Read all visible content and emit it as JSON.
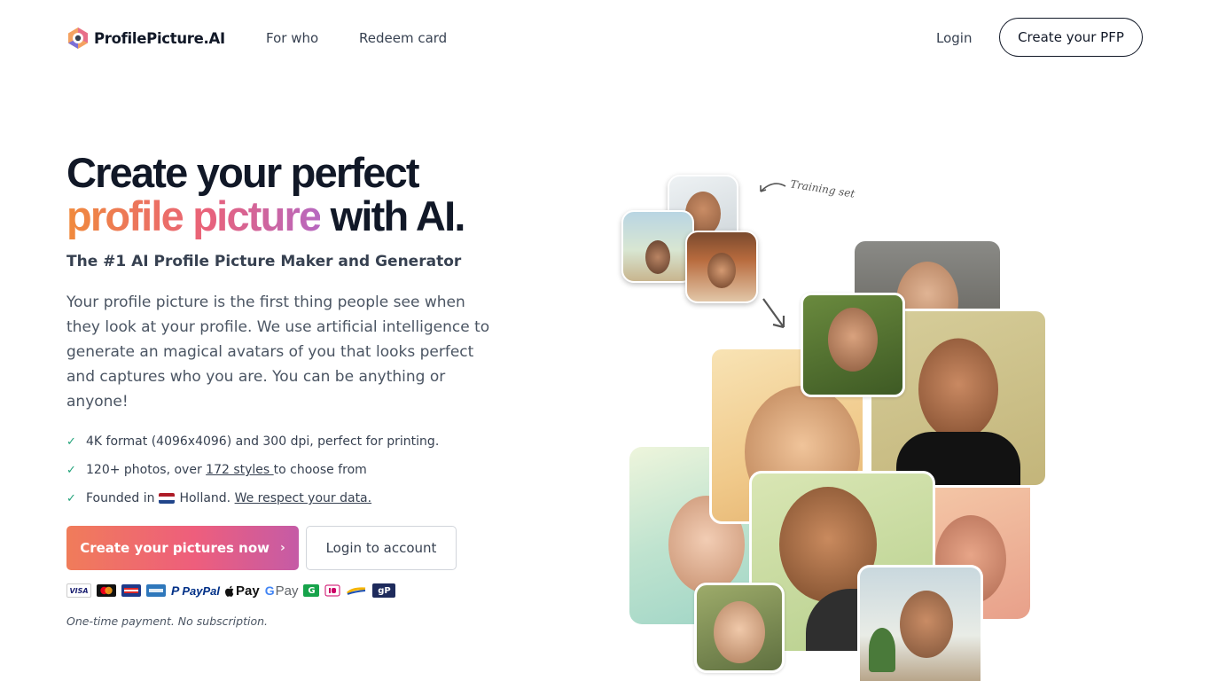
{
  "brand": {
    "name": "ProfilePicture.AI"
  },
  "nav": {
    "for_who": "For who",
    "redeem_card": "Redeem card",
    "login": "Login",
    "cta": "Create your PFP"
  },
  "hero": {
    "title_line1": "Create your perfect",
    "title_highlight": "profile picture",
    "title_rest": " with AI.",
    "subtitle": "The #1 AI Profile Picture Maker and Generator",
    "paragraph": "Your profile picture is the first thing people see when they look at your profile. We use artificial intelligence to generate an magical avatars of you that looks perfect and captures who you are. You can be anything or anyone!"
  },
  "features": {
    "f1": "4K format (4096x4096) and 300 dpi, perfect for printing.",
    "f2_pre": "120+ photos, over ",
    "f2_link": "172 styles ",
    "f2_post": "to choose from",
    "f3_pre": "Founded in",
    "f3_country": "Holland.",
    "f3_link": "We respect your data."
  },
  "cta": {
    "primary": "Create your pictures now",
    "secondary": "Login to account"
  },
  "payments": {
    "visa": "VISA",
    "paypal": "PayPal",
    "applepay": "Pay",
    "gpay": "Pay",
    "g_label": "G",
    "gp_label": "gP"
  },
  "note": "One-time payment. No subscription.",
  "collage": {
    "training_label": "Training set"
  },
  "colors": {
    "accent_orange": "#f08a3c",
    "accent_pink": "#e9627a",
    "accent_purple": "#b768c0",
    "check_green": "#22a37a"
  }
}
